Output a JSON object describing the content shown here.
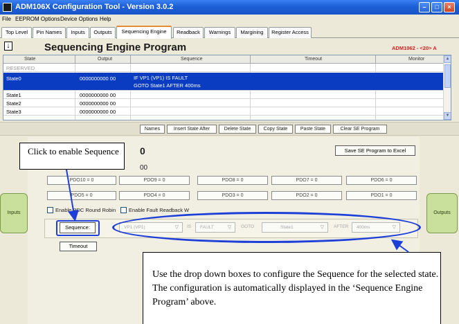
{
  "window": {
    "title": "ADM106X Configuration Tool - Version 3.0.2",
    "minimize_glyph": "–",
    "maximize_glyph": "□",
    "close_glyph": "×"
  },
  "menu": [
    "File",
    "EEPROM Options",
    "Device Options",
    "Help"
  ],
  "tabs": [
    "Top Level",
    "Pin Names",
    "Inputs",
    "Outputs",
    "Sequencing Engine",
    "Readback",
    "Warnings",
    "Margining",
    "Register Access"
  ],
  "active_tab": "Sequencing Engine",
  "header": {
    "down_glyph": "↓",
    "title": "Sequencing Engine Program",
    "device": "ADM1062 - <20> A"
  },
  "table": {
    "columns": [
      "State",
      "Output",
      "Sequence",
      "Timeout",
      "Monitor"
    ],
    "rows": [
      {
        "state": "RESERVED",
        "output": "",
        "sequence": "",
        "sequence2": ""
      },
      {
        "state": "State0",
        "output": "0000000000 00",
        "sequence": "IF VP1 (VP1) IS FAULT",
        "sequence2": "GOTO State1 AFTER 400ms"
      },
      {
        "state": "State1",
        "output": "0000000000 00",
        "sequence": "",
        "sequence2": ""
      },
      {
        "state": "State2",
        "output": "0000000000 00",
        "sequence": "",
        "sequence2": ""
      },
      {
        "state": "State3",
        "output": "0000000000 00",
        "sequence": "",
        "sequence2": ""
      }
    ],
    "scroll_up": "▲",
    "scroll_down": "▼"
  },
  "strip_buttons": [
    "Names",
    "Insert State After",
    "Delete State",
    "Copy State",
    "Paste State",
    "Clear SE Program"
  ],
  "panel": {
    "state_heading": "0",
    "state_value": "00",
    "save_button": "Save SE Program to Excel",
    "pdo_row1": [
      "PDO10 = 0",
      "PDO9 = 0",
      "PDO8 = 0",
      "PDO7 = 0",
      "PDO6 = 0"
    ],
    "pdo_row2": [
      "PDO5 = 0",
      "PDO4 = 0",
      "PDO3 = 0",
      "PDO2 = 0",
      "PDO1 = 0"
    ],
    "round_robin_label": "Enable PDC Round Robin",
    "fault_label": "Enable Fault Readback W",
    "inputs_button": "Inputs",
    "outputs_button": "Outputs",
    "sequence_label": "Sequence:",
    "seq_source": "VP1 (VP1)",
    "seq_is": "IS",
    "seq_condition": "FAULT",
    "seq_goto": "GOTO",
    "seq_target": "State1",
    "seq_after": "AFTER",
    "seq_time": "400ms",
    "dropdown_arrow": "▽",
    "timeout_button": "Timeout"
  },
  "annotations": {
    "callout_top": "Click to enable Sequence",
    "callout_bottom": "Use the drop down boxes to configure the Sequence for the selected state. The configuration is automatically displayed in the ‘Sequence Engine Program’ above.",
    "highlight_color": "#1d3fd8"
  }
}
